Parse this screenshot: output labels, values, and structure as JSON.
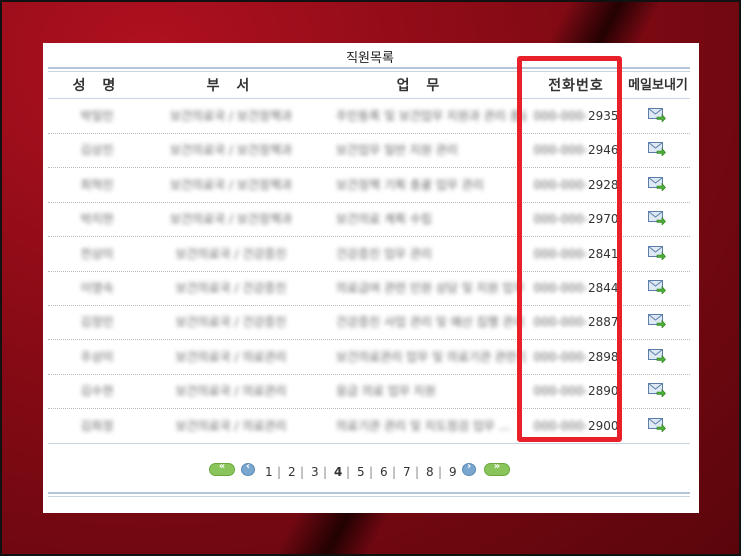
{
  "title": "직원목록",
  "columns": {
    "name": "성 명",
    "dept": "부 서",
    "task": "업 무",
    "phone": "전화번호",
    "mail": "메일보내기"
  },
  "rows": [
    {
      "name": "박일민",
      "dept": "보건의료국 / 보건정책과",
      "task": "주민등록 및 보건업무 지원과 관리 총괄",
      "phone_prefix": "000-000-",
      "phone_suffix": "2935"
    },
    {
      "name": "김상진",
      "dept": "보건의료국 / 보건정책과",
      "task": "보건업무 일반 지원 관리",
      "phone_prefix": "000-000-",
      "phone_suffix": "2946"
    },
    {
      "name": "최혁진",
      "dept": "보건의료국 / 보건정책과",
      "task": "보건정책 기획 총괄 업무 관리",
      "phone_prefix": "000-000-",
      "phone_suffix": "2928"
    },
    {
      "name": "박지현",
      "dept": "보건의료국 / 보건정책과",
      "task": "보건의료 계획 수립",
      "phone_prefix": "000-000-",
      "phone_suffix": "2970"
    },
    {
      "name": "전상미",
      "dept": "보건의료국 / 건강증진",
      "task": "건강증진 업무 관리",
      "phone_prefix": "000-000-",
      "phone_suffix": "2841"
    },
    {
      "name": "이영숙",
      "dept": "보건의료국 / 건강증진",
      "task": "의료급여 관련 민원 상담 및 지원 업무 ...",
      "phone_prefix": "000-000-",
      "phone_suffix": "2844"
    },
    {
      "name": "김정민",
      "dept": "보건의료국 / 건강증진",
      "task": "건강증진 사업 관리 및 예산 집행 관리 ...",
      "phone_prefix": "000-000-",
      "phone_suffix": "2887"
    },
    {
      "name": "주상미",
      "dept": "보건의료국 / 의료관리",
      "task": "보건의료관리 업무 및 의료기관 관련 민원",
      "phone_prefix": "000-000-",
      "phone_suffix": "2898"
    },
    {
      "name": "김수현",
      "dept": "보건의료국 / 의료관리",
      "task": "응급 의료 업무 지원",
      "phone_prefix": "000-000-",
      "phone_suffix": "2890"
    },
    {
      "name": "김희정",
      "dept": "보건의료국 / 의료관리",
      "task": "의료기관 관리 및 지도점검 업무 ...",
      "phone_prefix": "000-000-",
      "phone_suffix": "2900"
    }
  ],
  "pagination": {
    "first": "«",
    "prev": "‹",
    "pages": [
      "1",
      "2",
      "3",
      "4",
      "5",
      "6",
      "7",
      "8",
      "9"
    ],
    "current": "4",
    "next": "›",
    "last": "»"
  },
  "highlight_color": "#e8202a",
  "icons": {
    "mail": "mail-send-icon"
  }
}
